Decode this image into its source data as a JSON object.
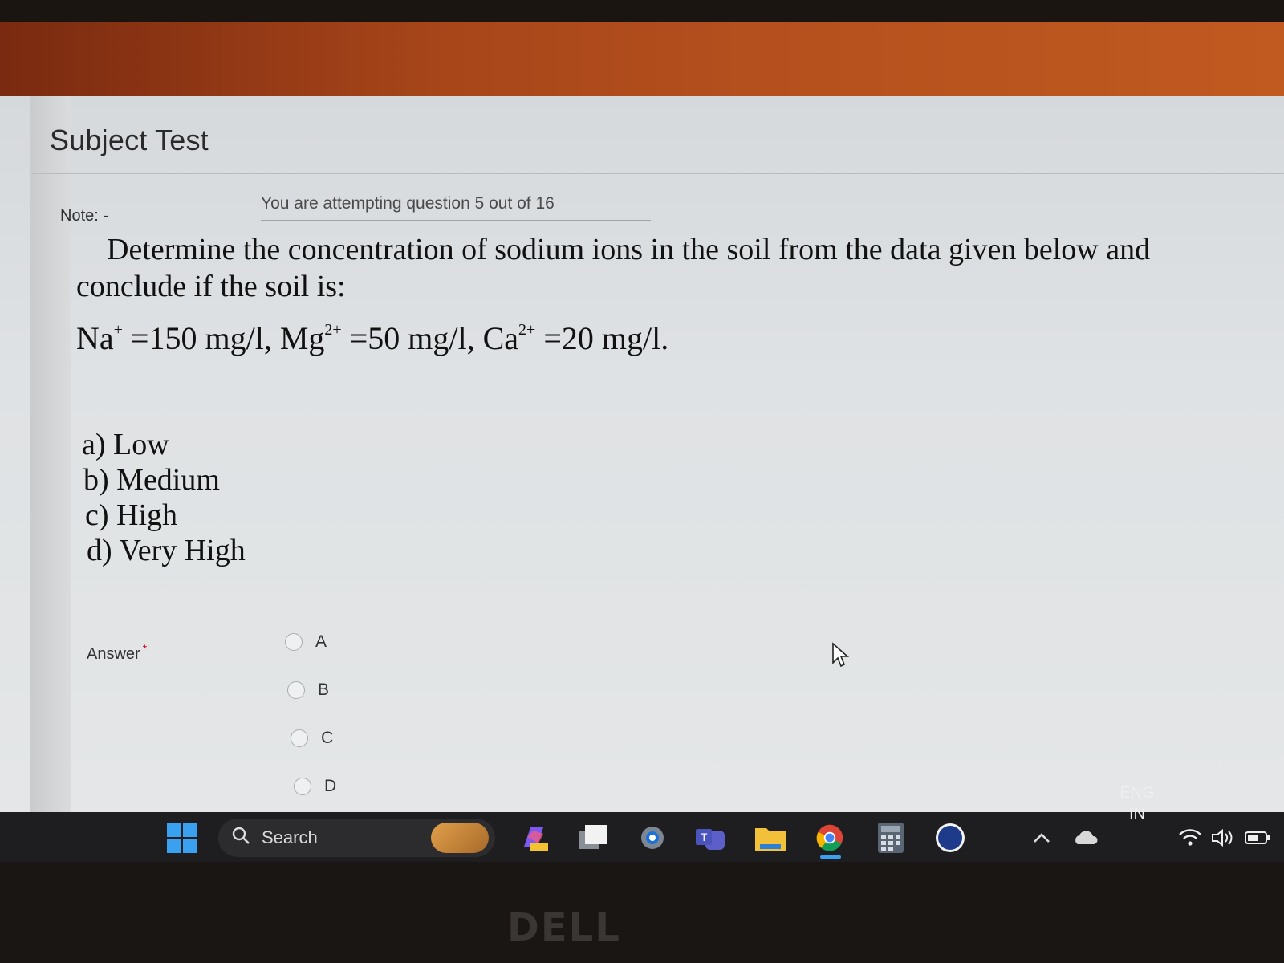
{
  "page": {
    "title": "Subject Test",
    "note_label": "Note: -",
    "progress": "You are attempting question 5 out of 16"
  },
  "question": {
    "line1": "Determine the concentration of sodium ions in the soil from the data given below and",
    "line2": "conclude if the soil is:",
    "formula": {
      "na": "Na",
      "na_sup": "+",
      "na_val": " =150 mg/l, ",
      "mg": "Mg",
      "mg_sup": "2+",
      "mg_val": " =50 mg/l, ",
      "ca": "Ca",
      "ca_sup": "2+",
      "ca_val": " =20 mg/l."
    },
    "options": [
      "a) Low",
      "b) Medium",
      "c) High",
      "d) Very High"
    ]
  },
  "answer": {
    "label": "Answer",
    "required_mark": "*",
    "choices": [
      "A",
      "B",
      "C",
      "D"
    ]
  },
  "taskbar": {
    "search_placeholder": "Search",
    "lang_line1": "ENG",
    "lang_line2": "IN"
  },
  "device": {
    "brand": "DELL"
  }
}
